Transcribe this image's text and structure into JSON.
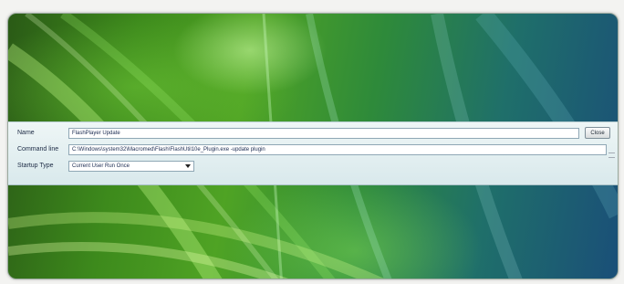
{
  "form": {
    "name_label": "Name",
    "name_value": "FlashPlayer Update",
    "command_label": "Command line",
    "command_value": "C:\\Windows\\system32\\Macromed\\Flash\\FlashUtil10e_Plugin.exe -update plugin",
    "startup_label": "Startup Type",
    "startup_value": "Current User Run Once",
    "close_label": "Close"
  },
  "colors": {
    "panel": "#e3eff1",
    "wallpaper_green": "#4fa324",
    "wallpaper_teal": "#1f6f6a"
  }
}
